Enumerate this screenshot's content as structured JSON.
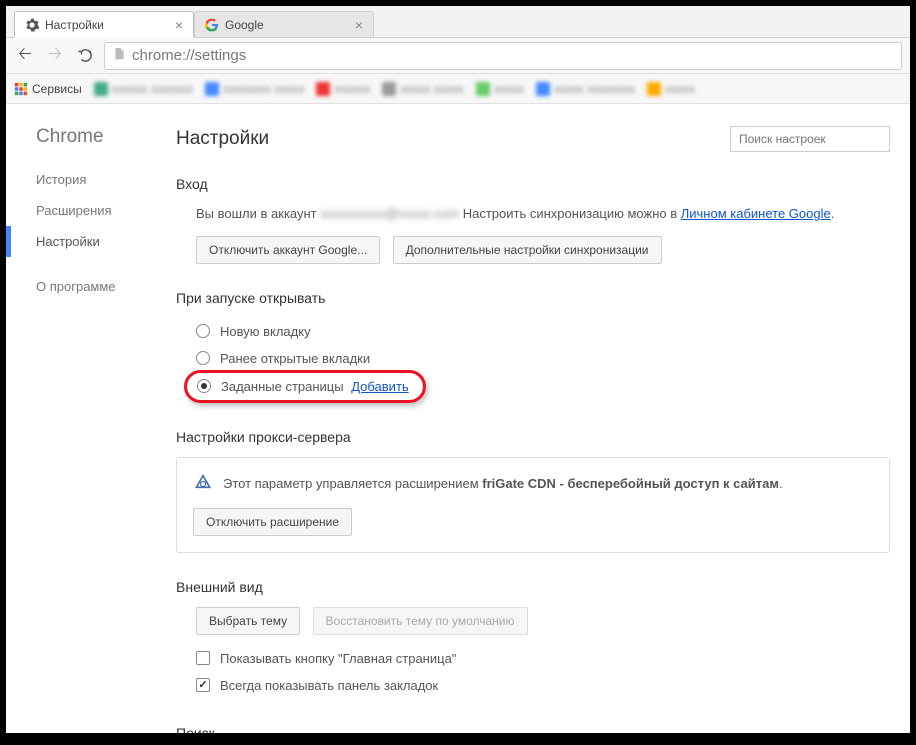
{
  "tabs": [
    {
      "title": "Настройки"
    },
    {
      "title": "Google"
    }
  ],
  "toolbar": {
    "url": "chrome://settings"
  },
  "bookmarks": {
    "apps_label": "Сервисы"
  },
  "sidebar": {
    "brand": "Chrome",
    "items": [
      "История",
      "Расширения",
      "Настройки",
      "О программе"
    ]
  },
  "header": {
    "title": "Настройки",
    "search_placeholder": "Поиск настроек"
  },
  "login_section": {
    "title": "Вход",
    "text_prefix": "Вы вошли в аккаунт ",
    "text_suffix": " Настроить синхронизацию можно в ",
    "link_text": "Личном кабинете Google",
    "period": ".",
    "disconnect_btn": "Отключить аккаунт Google...",
    "sync_btn": "Дополнительные настройки синхронизации"
  },
  "startup_section": {
    "title": "При запуске открывать",
    "opt_newtab": "Новую вкладку",
    "opt_recent": "Ранее открытые вкладки",
    "opt_specific": "Заданные страницы",
    "add_link": "Добавить"
  },
  "proxy_section": {
    "title": "Настройки прокси-сервера",
    "text_prefix": "Этот параметр управляется расширением ",
    "ext_name": "friGate CDN - бесперебойный доступ к сайтам",
    "period": ".",
    "disable_btn": "Отключить расширение"
  },
  "appearance_section": {
    "title": "Внешний вид",
    "theme_btn": "Выбрать тему",
    "reset_theme_btn": "Восстановить тему по умолчанию",
    "show_home": "Показывать кнопку \"Главная страница\"",
    "show_bookmarks": "Всегда показывать панель закладок"
  },
  "search_section": {
    "title": "Поиск"
  }
}
